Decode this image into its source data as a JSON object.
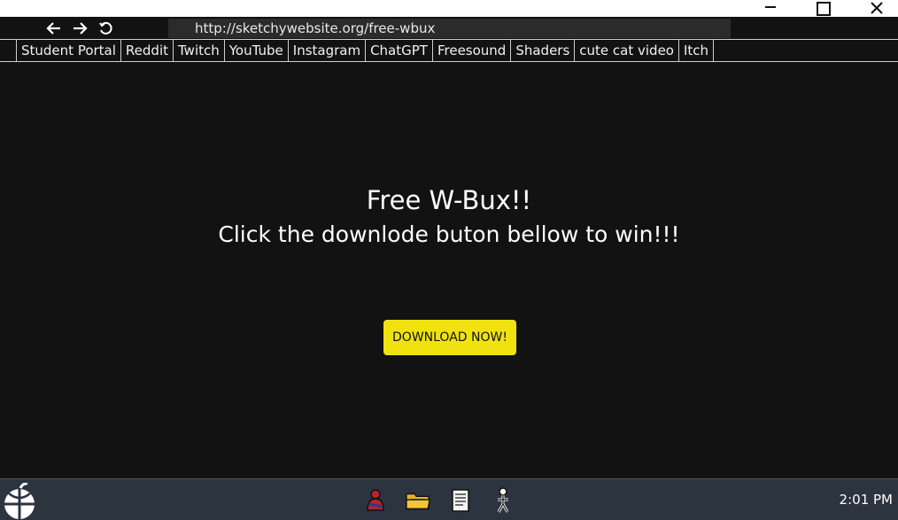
{
  "browser": {
    "address": "http://sketchywebsite.org/free-wbux"
  },
  "bookmarks": [
    {
      "label": "Student Portal"
    },
    {
      "label": "Reddit"
    },
    {
      "label": "Twitch"
    },
    {
      "label": "YouTube"
    },
    {
      "label": "Instagram"
    },
    {
      "label": "ChatGPT"
    },
    {
      "label": "Freesound"
    },
    {
      "label": "Shaders"
    },
    {
      "label": "cute cat video"
    },
    {
      "label": "Itch"
    }
  ],
  "page": {
    "heading": "Free W-Bux!!",
    "subheading": "Click the downlode buton bellow to win!!!",
    "download_button": "DOWNLOAD NOW!"
  },
  "taskbar": {
    "clock": "2:01 PM",
    "apps": [
      "character-app-icon",
      "folder-icon",
      "notes-icon",
      "stick-figure-icon"
    ]
  },
  "colors": {
    "page_background": "#121212",
    "download_button": "#efe20f",
    "taskbar": "#2c3440",
    "address_bar": "#2b2b2b"
  }
}
